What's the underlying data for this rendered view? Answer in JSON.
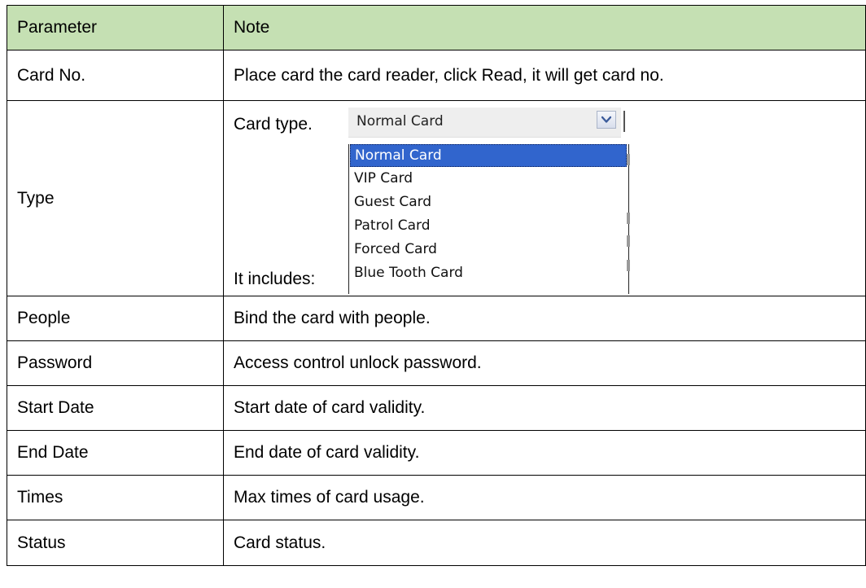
{
  "table": {
    "header": {
      "param": "Parameter",
      "note": "Note"
    },
    "rows": [
      {
        "param": "Card No.",
        "note": "Place card the card reader, click Read, it will get card no."
      },
      {
        "param": "Type",
        "note_top": "Card type.",
        "note_bottom": "It includes:"
      },
      {
        "param": "People",
        "note": "Bind the card with people."
      },
      {
        "param": "Password",
        "note": "Access control unlock password."
      },
      {
        "param": "Start Date",
        "note": "Start date of card validity."
      },
      {
        "param": "End Date",
        "note": "End date of card validity."
      },
      {
        "param": "Times",
        "note": "Max times of card usage."
      },
      {
        "param": "Status",
        "note": "Card status."
      }
    ]
  },
  "type_dropdown": {
    "selected_value": "Normal Card",
    "options": [
      "Normal Card",
      "VIP Card",
      "Guest Card",
      "Patrol Card",
      "Forced Card",
      "Blue Tooth Card"
    ],
    "highlighted_index": 0,
    "icon": "chevron-down-icon"
  },
  "colors": {
    "header_bg": "#c5e0b3",
    "highlight": "#3165cd"
  }
}
